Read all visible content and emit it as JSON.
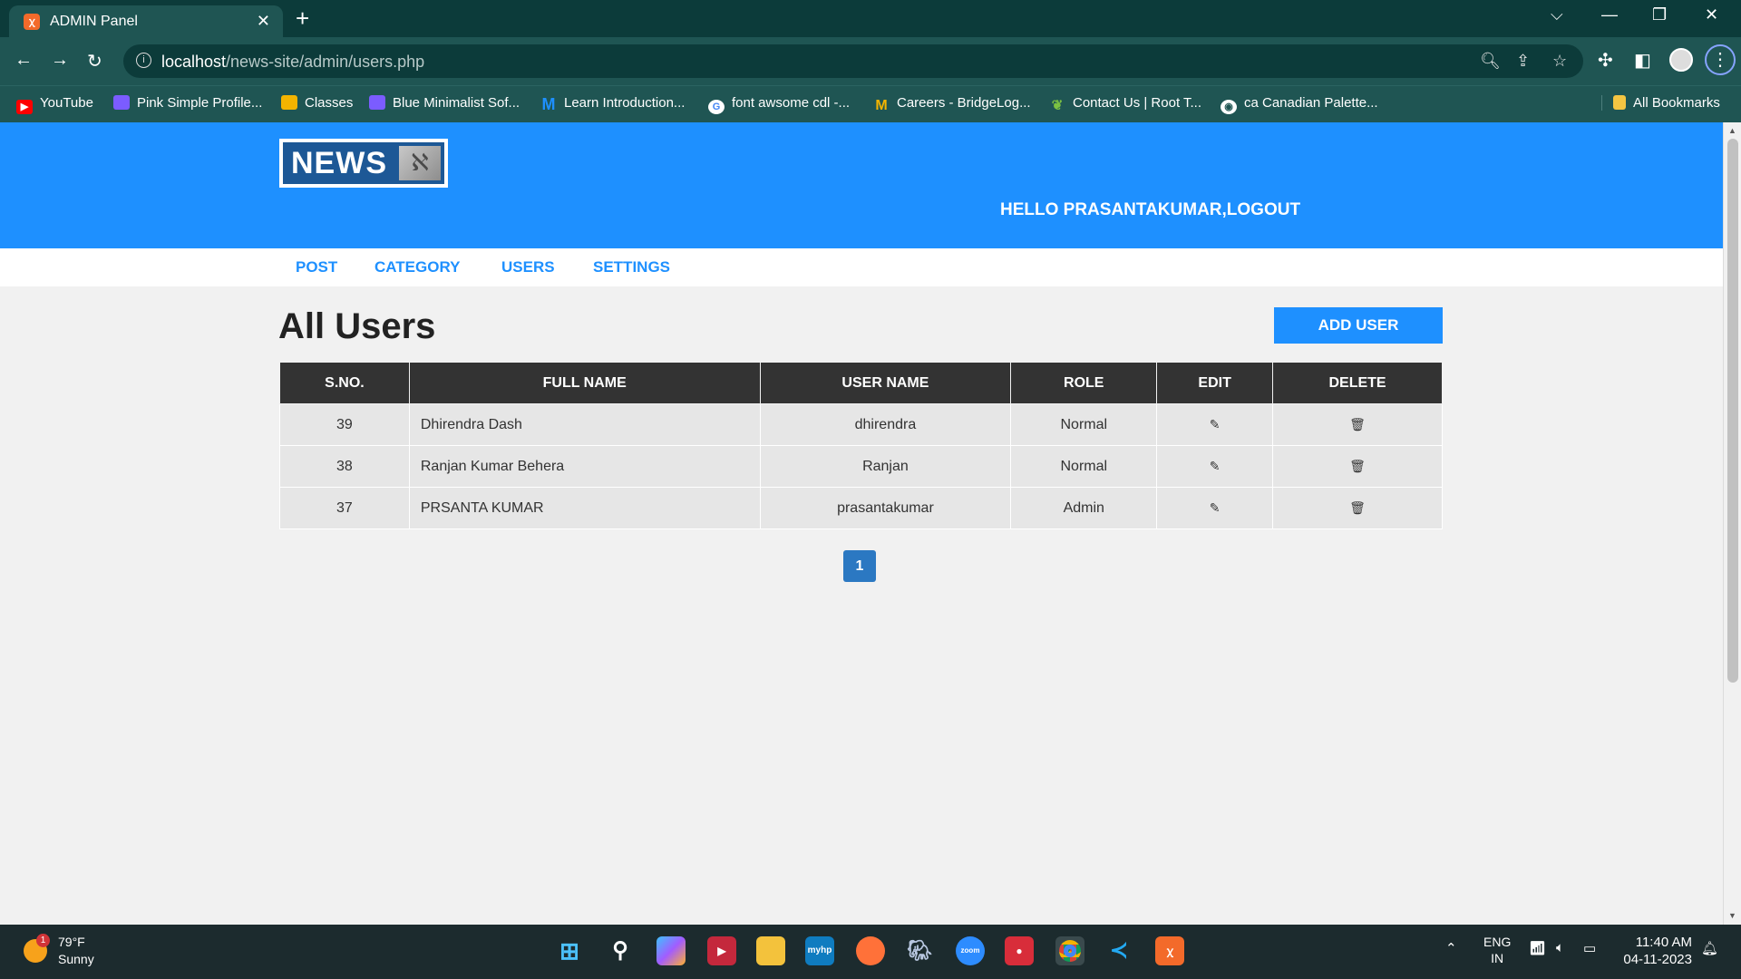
{
  "browser": {
    "tab_title": "ADMIN Panel",
    "url_host": "localhost",
    "url_path": "/news-site/admin/users.php",
    "bookmarks": [
      {
        "label": "YouTube",
        "icon": "youtube-icon",
        "color": "#ff0000"
      },
      {
        "label": "Pink Simple Profile...",
        "icon": "form-icon",
        "color": "#7b5cff"
      },
      {
        "label": "Classes",
        "icon": "classroom-icon",
        "color": "#f4b400"
      },
      {
        "label": "Blue Minimalist Sof...",
        "icon": "form-icon",
        "color": "#7b5cff"
      },
      {
        "label": "Learn Introduction...",
        "icon": "m-icon",
        "color": "#1e90ff"
      },
      {
        "label": "font awsome cdl -...",
        "icon": "google-icon",
        "color": "#ffffff"
      },
      {
        "label": "Careers - BridgeLog...",
        "icon": "m-icon",
        "color": "#f4b400"
      },
      {
        "label": "Contact Us | Root T...",
        "icon": "leaf-icon",
        "color": "#7cc242"
      },
      {
        "label": "ca Canadian Palette...",
        "icon": "globe-icon",
        "color": "#ffffff"
      }
    ],
    "all_bookmarks": "All Bookmarks"
  },
  "site": {
    "logo_text": "NEWS",
    "greeting": "HELLO PRASANTAKUMAR,LOGOUT",
    "menu": [
      "POST",
      "CATEGORY",
      "USERS",
      "SETTINGS"
    ],
    "heading": "All Users",
    "add_button": "ADD USER",
    "table": {
      "headers": [
        "S.NO.",
        "FULL NAME",
        "USER NAME",
        "ROLE",
        "EDIT",
        "DELETE"
      ],
      "rows": [
        {
          "sno": "39",
          "full_name": "Dhirendra Dash",
          "user_name": "dhirendra",
          "role": "Normal"
        },
        {
          "sno": "38",
          "full_name": "Ranjan Kumar Behera",
          "user_name": "Ranjan",
          "role": "Normal"
        },
        {
          "sno": "37",
          "full_name": "PRSANTA KUMAR",
          "user_name": "prasantakumar",
          "role": "Admin"
        }
      ]
    },
    "page_number": "1"
  },
  "taskbar": {
    "weather_badge": "1",
    "temperature": "79°F",
    "condition": "Sunny",
    "lang_top": "ENG",
    "lang_bottom": "IN",
    "time": "11:40 AM",
    "date": "04-11-2023"
  },
  "colors": {
    "header_blue": "#1e90ff",
    "table_head": "#333333",
    "chrome_dark": "#0c3b3a",
    "chrome_mid": "#1f5553"
  }
}
